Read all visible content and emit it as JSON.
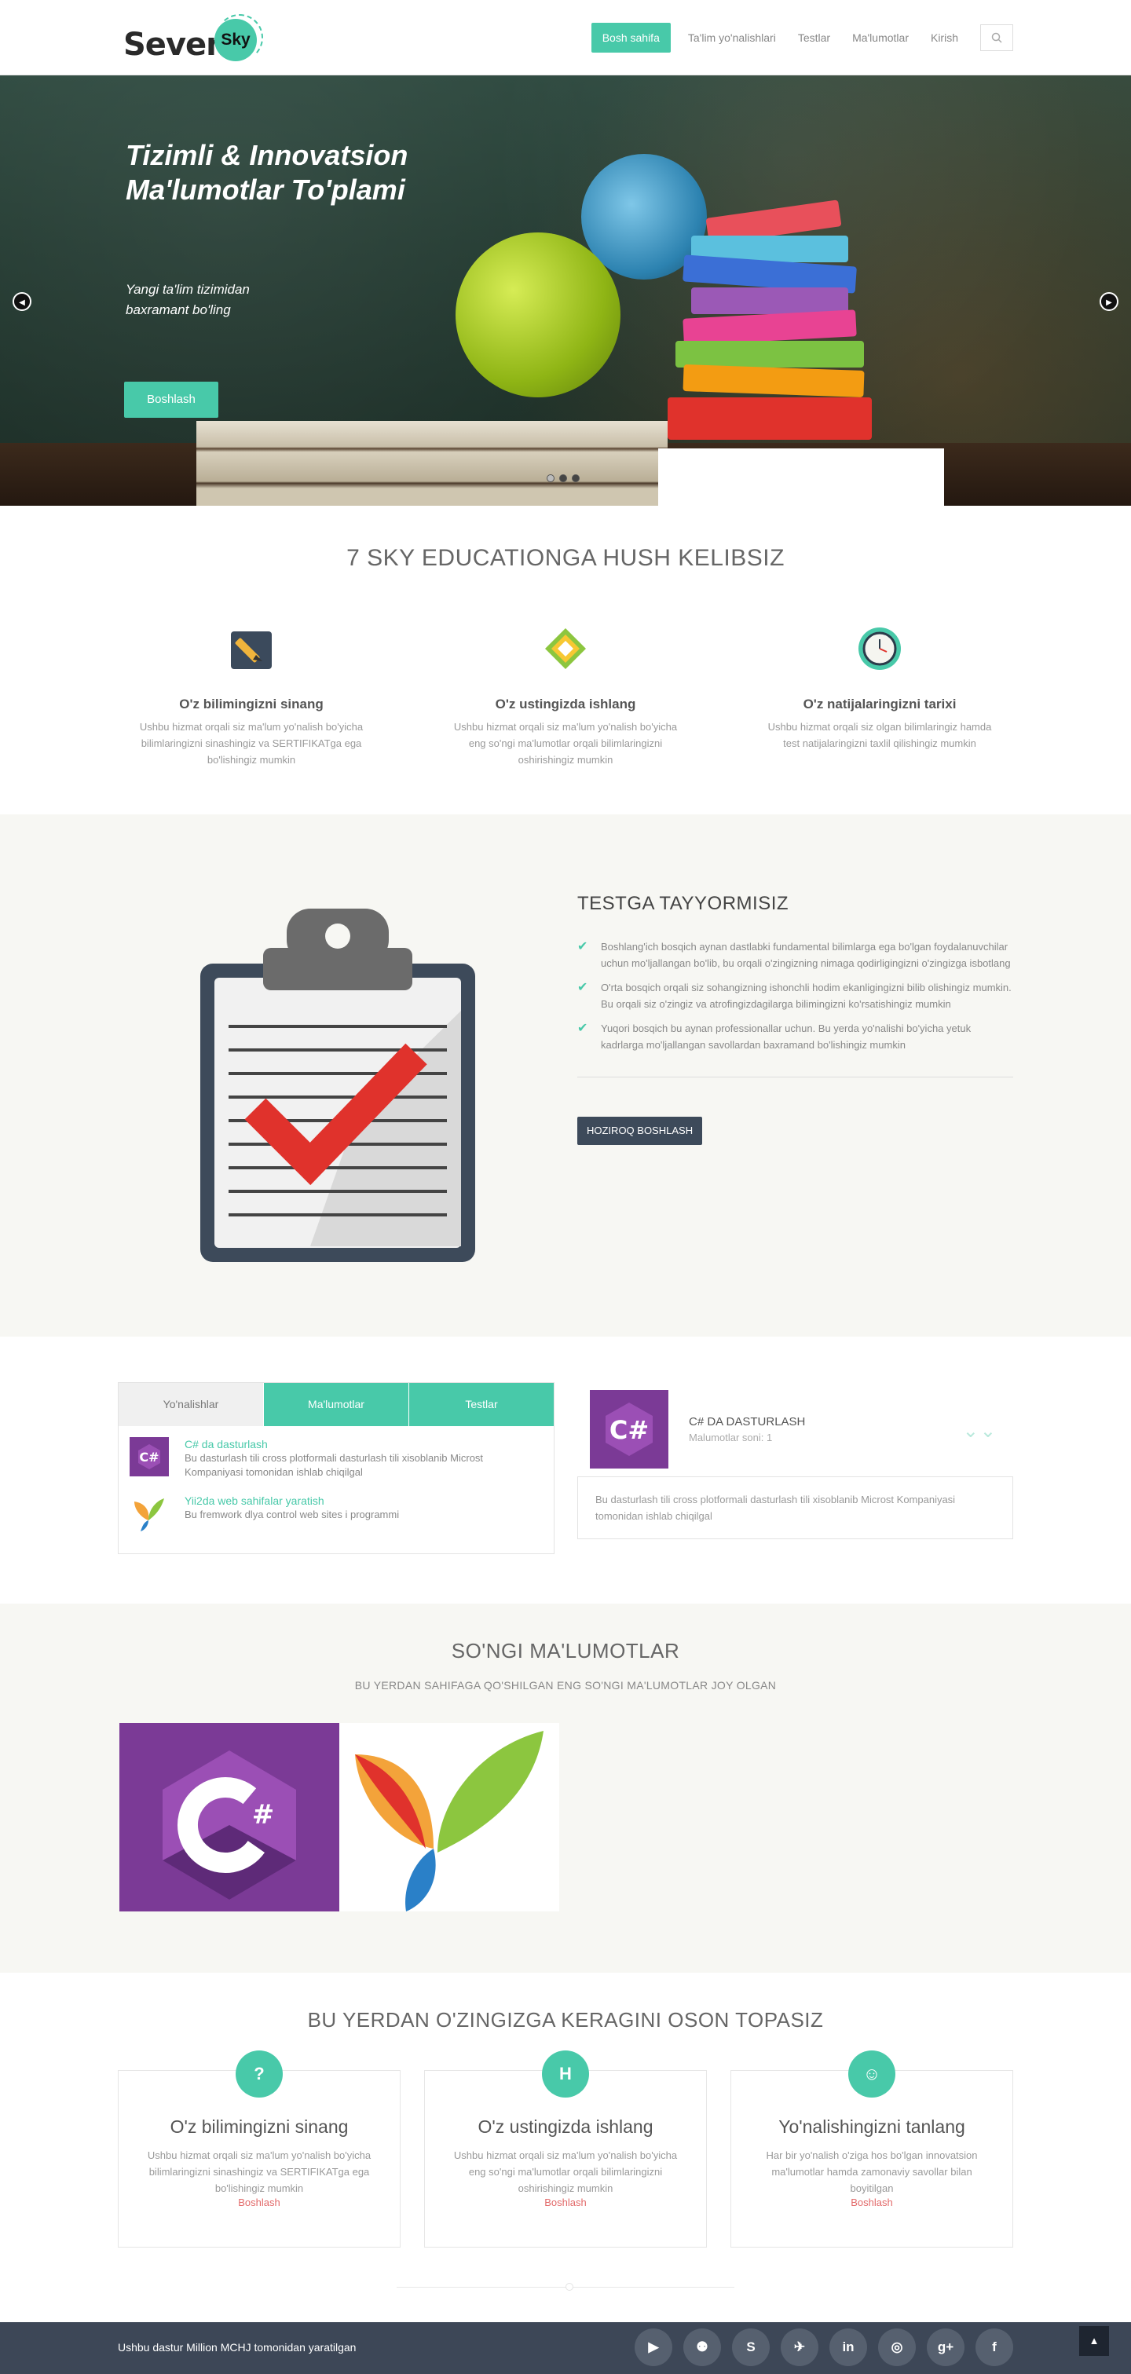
{
  "brand": {
    "logo_main": "Seven",
    "logo_badge": "Sky"
  },
  "nav": {
    "items": [
      "Bosh sahifa",
      "Ta'lim yo'nalishlari",
      "Testlar",
      "Ma'lumotlar",
      "Kirish"
    ],
    "search_icon": "search-icon"
  },
  "hero": {
    "title": "Tizimli & Innovatsion Ma'lumotlar To'plami",
    "subtitle": "Yangi ta'lim tizimidan baxramant bo'ling",
    "cta": "Boshlash",
    "prev_icon": "chevron-left-icon",
    "next_icon": "chevron-right-icon",
    "slides": 3,
    "active_slide": 2
  },
  "welcome": {
    "title": "7 SKY EDUCATIONGA HUSH KELIBSIZ",
    "features": [
      {
        "icon": "pencil-icon",
        "title": "O'z bilimingizni sinang",
        "text": "Ushbu hizmat orqali siz ma'lum yo'nalish bo'yicha bilimlaringizni sinashingiz va SERTIFIKATga ega bo'lishingiz mumkin"
      },
      {
        "icon": "recycle-icon",
        "title": "O'z ustingizda ishlang",
        "text": "Ushbu hizmat orqali siz ma'lum yo'nalish bo'yicha eng so'ngi ma'lumotlar orqali bilimlaringizni oshirishingiz mumkin"
      },
      {
        "icon": "clock-icon",
        "title": "O'z natijalaringizni tarixi",
        "text": "Ushbu hizmat orqali siz olgan bilimlaringiz hamda test natijalaringizni taxlil qilishingiz mumkin"
      }
    ]
  },
  "testga": {
    "title": "TESTGA TAYYORMISIZ",
    "checks": [
      "Boshlang'ich bosqich aynan dastlabki fundamental bilimlarga ega bo'lgan foydalanuvchilar uchun mo'ljallangan bo'lib, bu orqali o'zingizning nimaga qodirligingizni o'zingizga isbotlang",
      "O'rta bosqich orqali siz sohangizning ishonchli hodim ekanligingizni bilib olishingiz mumkin. Bu orqali siz o'zingiz va atrofingizdagilarga bilimingizni ko'rsatishingiz mumkin",
      "Yuqori bosqich bu aynan professionallar uchun. Bu yerda yo'nalishi bo'yicha yetuk kadrlarga mo'ljallangan savollardan baxramand bo'lishingiz mumkin"
    ],
    "button": "HOZIROQ BOSHLASH"
  },
  "tabs": {
    "labels": [
      "Yo'nalishlar",
      "Ma'lumotlar",
      "Testlar"
    ],
    "items": [
      {
        "title": "C# da dasturlash",
        "desc": "Bu dasturlash tili cross plotformali dasturlash tili xisoblanib Microst Kompaniyasi tomonidan ishlab chiqilgal"
      },
      {
        "title": "Yii2da web sahifalar yaratish",
        "desc": "Bu fremwork dlya control web sites i programmi"
      }
    ]
  },
  "course_card": {
    "title": "C# DA DASTURLASH",
    "count": "Malumotlar soni: 1",
    "desc": "Bu dasturlash tili cross plotformali dasturlash tili xisoblanib Microst Kompaniyasi tomonidan ishlab chiqilgal"
  },
  "recent": {
    "title": "SO'NGI MA'LUMOTLAR",
    "subtitle": "BU YERDAN SAHIFAGA QO'SHILGAN ENG SO'NGI MA'LUMOTLAR JOY OLGAN"
  },
  "find": {
    "title": "BU YERDAN O'ZINGIZGA KERAGINI OSON TOPASIZ",
    "boxes": [
      {
        "icon": "question-icon",
        "glyph": "?",
        "title": "O'z bilimingizni sinang",
        "text": "Ushbu hizmat orqali siz ma'lum yo'nalish bo'yicha bilimlaringizni sinashingiz va SERTIFIKATga ega bo'lishingiz mumkin",
        "link": "Boshlash"
      },
      {
        "icon": "h-square-icon",
        "glyph": "H",
        "title": "O'z ustingizda ishlang",
        "text": "Ushbu hizmat orqali siz ma'lum yo'nalish bo'yicha eng so'ngi ma'lumotlar orqali bilimlaringizni oshirishingiz mumkin",
        "link": "Boshlash"
      },
      {
        "icon": "users-icon",
        "glyph": "☺",
        "title": "Yo'nalishingizni tanlang",
        "text": "Har bir yo'nalish o'ziga hos bo'lgan innovatsion ma'lumotlar hamda zamonaviy savollar bilan boyitilgan",
        "link": "Boshlash"
      }
    ]
  },
  "footer": {
    "copyright": "Ushbu dastur Million MCHJ tomonidan yaratilgan",
    "socials": [
      {
        "icon": "youtube-icon",
        "glyph": "▶"
      },
      {
        "icon": "github-icon",
        "glyph": "⚉"
      },
      {
        "icon": "skype-icon",
        "glyph": "S"
      },
      {
        "icon": "twitter-icon",
        "glyph": "✈"
      },
      {
        "icon": "linkedin-icon",
        "glyph": "in"
      },
      {
        "icon": "dribbble-icon",
        "glyph": "◎"
      },
      {
        "icon": "google-plus-icon",
        "glyph": "g+"
      },
      {
        "icon": "facebook-icon",
        "glyph": "f"
      }
    ],
    "to_top_icon": "arrow-up-icon"
  },
  "colors": {
    "accent": "#48c9a9",
    "dark": "#3d4a5a",
    "link_red": "#e26a6a",
    "footer_bg": "#3d4757"
  }
}
